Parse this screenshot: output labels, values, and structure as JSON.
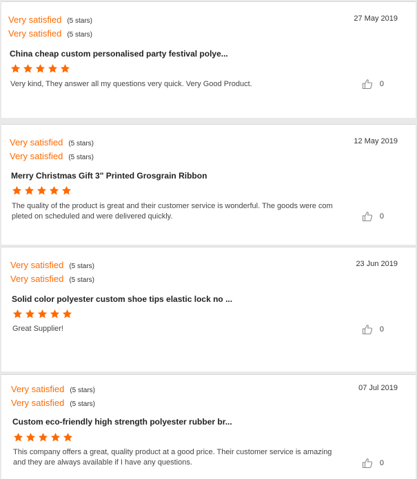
{
  "accent_color": "#ff6a00",
  "reviews": [
    {
      "rating_label_1": "Very satisfied",
      "rating_level_1": "(5 stars)",
      "rating_label_2": "Very satisfied",
      "rating_level_2": "(5 stars)",
      "date": "27 May 2019",
      "product": "China cheap custom personalised party festival polye...",
      "stars": 5,
      "comment": "Very kind, They answer all my questions very quick.  Very Good Product.",
      "likes": "0"
    },
    {
      "rating_label_1": "Very satisfied",
      "rating_level_1": "(5 stars)",
      "rating_label_2": "Very satisfied",
      "rating_level_2": "(5 stars)",
      "date": "12 May 2019",
      "product": "Merry Christmas Gift 3\" Printed Grosgrain Ribbon",
      "stars": 5,
      "comment": "The quality of the product is great and their customer service is wonderful. The goods were completed on scheduled and were delivered quickly.",
      "likes": "0"
    },
    {
      "rating_label_1": "Very satisfied",
      "rating_level_1": "(5 stars)",
      "rating_label_2": "Very satisfied",
      "rating_level_2": "(5 stars)",
      "date": "23 Jun 2019",
      "product": "Solid color polyester custom shoe tips elastic lock no ...",
      "stars": 5,
      "comment": "Great Supplier!",
      "likes": "0"
    },
    {
      "rating_label_1": "Very satisfied",
      "rating_level_1": "(5 stars)",
      "rating_label_2": "Very satisfied",
      "rating_level_2": "(5 stars)",
      "date": "07 Jul 2019",
      "product": "Custom eco-friendly high strength polyester rubber br...",
      "stars": 5,
      "comment": "This company offers a great, quality product at a good price. Their customer service is amazing and they are always available if I have any questions.",
      "likes": "0"
    }
  ]
}
